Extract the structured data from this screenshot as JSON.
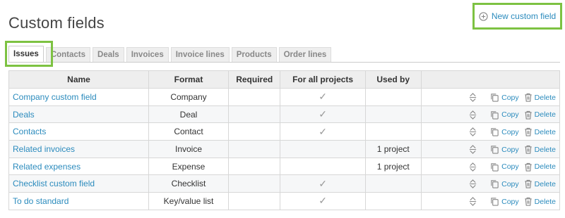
{
  "page": {
    "title": "Custom fields"
  },
  "new_button": {
    "label": "New custom field",
    "icon": "plus-circle-icon"
  },
  "tabs": [
    {
      "label": "Issues",
      "active": true
    },
    {
      "label": "Contacts",
      "active": false
    },
    {
      "label": "Deals",
      "active": false
    },
    {
      "label": "Invoices",
      "active": false
    },
    {
      "label": "Invoice lines",
      "active": false
    },
    {
      "label": "Products",
      "active": false
    },
    {
      "label": "Order lines",
      "active": false
    }
  ],
  "table": {
    "headers": {
      "name": "Name",
      "format": "Format",
      "required": "Required",
      "all_projects": "For all projects",
      "used_by": "Used by",
      "actions": ""
    },
    "rows": [
      {
        "name": "Company custom field",
        "format": "Company",
        "required": false,
        "all_projects": true,
        "used_by": ""
      },
      {
        "name": "Deals",
        "format": "Deal",
        "required": false,
        "all_projects": true,
        "used_by": ""
      },
      {
        "name": "Contacts",
        "format": "Contact",
        "required": false,
        "all_projects": true,
        "used_by": ""
      },
      {
        "name": "Related invoices",
        "format": "Invoice",
        "required": false,
        "all_projects": false,
        "used_by": "1 project"
      },
      {
        "name": "Related expenses",
        "format": "Expense",
        "required": false,
        "all_projects": false,
        "used_by": "1 project"
      },
      {
        "name": "Checklist custom field",
        "format": "Checklist",
        "required": false,
        "all_projects": true,
        "used_by": ""
      },
      {
        "name": "To do standard",
        "format": "Key/value list",
        "required": false,
        "all_projects": true,
        "used_by": ""
      }
    ],
    "actions": {
      "copy_label": "Copy",
      "delete_label": "Delete",
      "sort_icon": "sort-handle-icon",
      "copy_icon": "copy-icon",
      "delete_icon": "trash-icon"
    }
  },
  "colors": {
    "link": "#2b8bbd",
    "highlight": "#7dc242",
    "header_bg": "#eeeeee",
    "border": "#d7d7d7"
  }
}
